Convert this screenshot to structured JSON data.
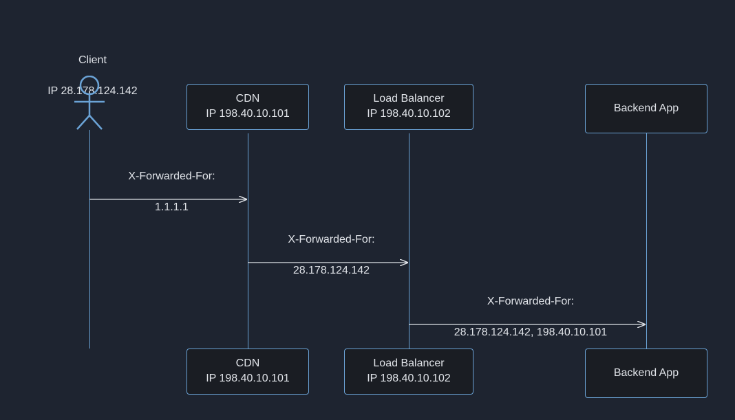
{
  "actors": {
    "client": {
      "name": "Client",
      "ip_label": "IP 28.178.124.142"
    },
    "cdn": {
      "name": "CDN",
      "ip_label": "IP 198.40.10.101"
    },
    "load_balancer": {
      "name": "Load Balancer",
      "ip_label": "IP 198.40.10.102"
    },
    "backend": {
      "name": "Backend App"
    }
  },
  "messages": {
    "m1": {
      "header": "X-Forwarded-For:",
      "value": "1.1.1.1"
    },
    "m2": {
      "header": "X-Forwarded-For:",
      "value": "28.178.124.142"
    },
    "m3": {
      "header": "X-Forwarded-For:",
      "value": "28.178.124.142, 198.40.10.101"
    }
  }
}
